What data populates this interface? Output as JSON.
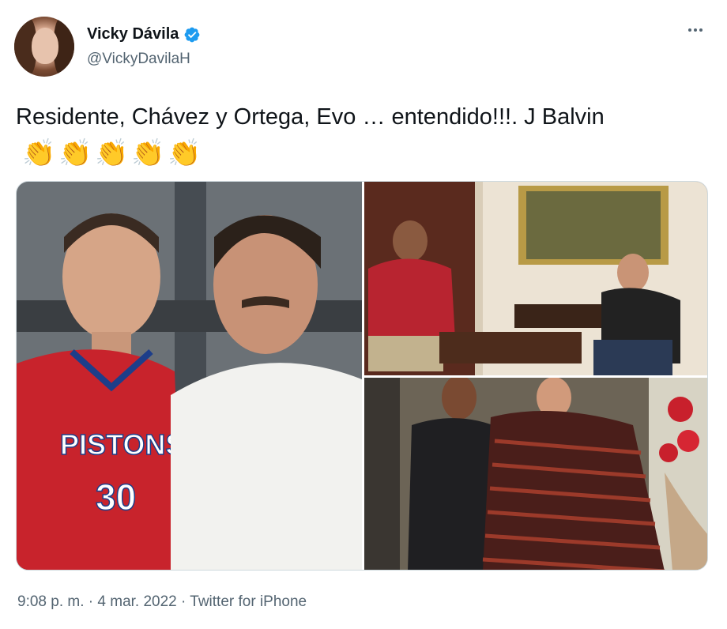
{
  "user": {
    "display_name": "Vicky Dávila",
    "handle": "@VickyDavilaH"
  },
  "tweet": {
    "text": "Residente, Chávez y Ortega, Evo … entendido!!!. J Balvin",
    "emoji": [
      "👏",
      "👏",
      "👏",
      "👏",
      "👏"
    ],
    "jersey_team": "PISTONS",
    "jersey_number": "30"
  },
  "meta": {
    "time": "9:08 p. m.",
    "date": "4 mar. 2022",
    "source": "Twitter for iPhone"
  },
  "icons": {
    "verified": "verified-badge-icon",
    "more": "more-options-icon",
    "clap": "clapping-hands-emoji"
  },
  "colors": {
    "text_primary": "#0f1419",
    "text_secondary": "#536471",
    "verified_blue": "#1d9bf0",
    "border": "#cfd9de"
  }
}
